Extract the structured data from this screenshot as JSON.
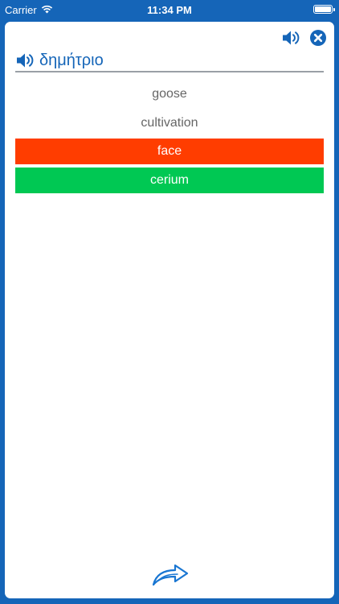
{
  "status_bar": {
    "carrier": "Carrier",
    "time": "11:34 PM",
    "battery_level": 1.0
  },
  "header": {
    "speaker_icon": "speaker-icon",
    "close_icon": "close-circle-icon"
  },
  "question": {
    "word": "δημήτριο",
    "speaker_icon": "speaker-icon"
  },
  "options": [
    {
      "label": "goose",
      "state": "neutral"
    },
    {
      "label": "cultivation",
      "state": "neutral"
    },
    {
      "label": "face",
      "state": "wrong"
    },
    {
      "label": "cerium",
      "state": "correct"
    }
  ],
  "footer": {
    "next_icon": "curved-arrow-right-icon"
  },
  "colors": {
    "brand_blue": "#1565b8",
    "wrong_red": "#ff3d00",
    "correct_green": "#00c853",
    "option_text_gray": "#666666"
  }
}
